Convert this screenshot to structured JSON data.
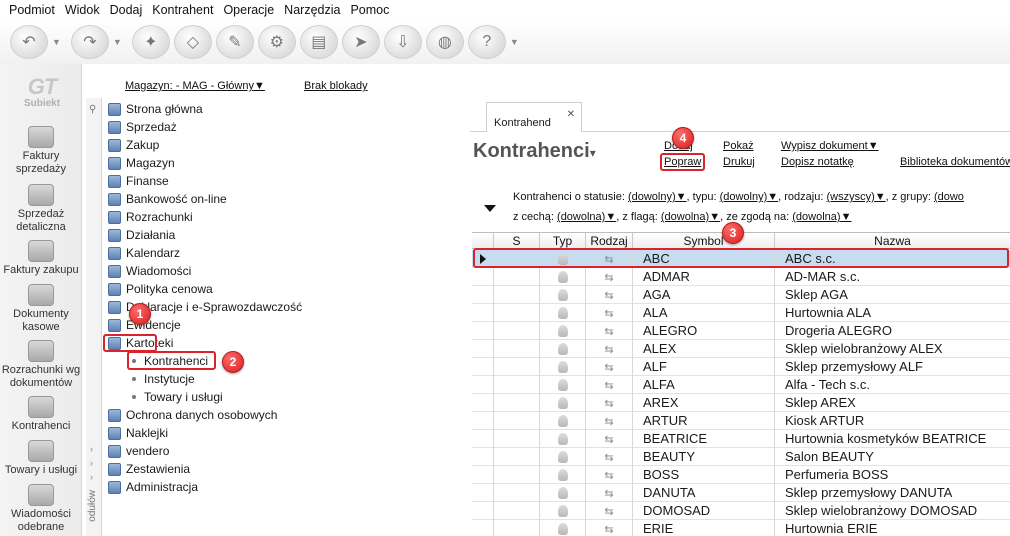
{
  "menu": [
    "Podmiot",
    "Widok",
    "Dodaj",
    "Kontrahent",
    "Operacje",
    "Narzędzia",
    "Pomoc"
  ],
  "logo": {
    "mark": "GT",
    "name": "Subiekt"
  },
  "sidebar": [
    {
      "label": "Faktury sprzedaży",
      "icon": "sales-invoice-icon"
    },
    {
      "label": "Sprzedaż detaliczna",
      "icon": "retail-sales-icon"
    },
    {
      "label": "Faktury zakupu",
      "icon": "purchase-invoice-icon"
    },
    {
      "label": "Dokumenty kasowe",
      "icon": "cash-documents-icon"
    },
    {
      "label": "Rozrachunki wg dokumentów",
      "icon": "settlements-icon"
    },
    {
      "label": "Kontrahenci",
      "icon": "contractors-icon"
    },
    {
      "label": "Towary i usługi",
      "icon": "goods-icon"
    },
    {
      "label": "Wiadomości odebrane",
      "icon": "messages-icon"
    }
  ],
  "infobar": {
    "magazyn": "Magazyn: - MAG - Główny",
    "blokady": "Brak blokady"
  },
  "tree": {
    "strip_label": "odułów",
    "items": [
      {
        "label": "Strona główna"
      },
      {
        "label": "Sprzedaż"
      },
      {
        "label": "Zakup"
      },
      {
        "label": "Magazyn"
      },
      {
        "label": "Finanse"
      },
      {
        "label": "Bankowość on-line"
      },
      {
        "label": "Rozrachunki"
      },
      {
        "label": "Działania"
      },
      {
        "label": "Kalendarz"
      },
      {
        "label": "Wiadomości"
      },
      {
        "label": "Polityka cenowa"
      },
      {
        "label": "Deklaracje i e-Sprawozdawczość"
      },
      {
        "label": "Ewidencje"
      },
      {
        "label": "Kartoteki"
      },
      {
        "label": "Kontrahenci",
        "child": true
      },
      {
        "label": "Instytucje",
        "child": true
      },
      {
        "label": "Towary i usługi",
        "child": true
      },
      {
        "label": "Ochrona danych osobowych"
      },
      {
        "label": "Naklejki"
      },
      {
        "label": "vendero"
      },
      {
        "label": "Zestawienia"
      },
      {
        "label": "Administracja"
      }
    ]
  },
  "tab": {
    "label": "Kontrahend",
    "close": "✕"
  },
  "title": "Kontrahenci",
  "actions": {
    "dodaj": "Dodaj",
    "popraw": "Popraw",
    "pokaz": "Pokaż",
    "drukuj": "Drukuj",
    "wypisz": "Wypisz dokument",
    "notatka": "Dopisz notatkę",
    "biblioteka": "Biblioteka dokumentów"
  },
  "filters": {
    "status_label": "Kontrahenci o statusie:",
    "status_value": "(dowolny)",
    "typ_label": ", typu:",
    "typ_value": "(dowolny)",
    "rodzaj_label": ", rodzaju:",
    "rodzaj_value": "(wszyscy)",
    "grupa_label": ", z grupy:",
    "grupa_value": "(dowo",
    "cecha_label": "z cechą:",
    "cecha_value": "(dowolna)",
    "flaga_label": ", z flagą:",
    "flaga_value": "(dowolna)",
    "zgoda_label": ", ze zgodą na:",
    "zgoda_value": "(dowolna)"
  },
  "columns": {
    "s": "S",
    "typ": "Typ",
    "rodzaj": "Rodzaj",
    "symbol": "Symbol",
    "nazwa": "Nazwa"
  },
  "rows": [
    {
      "symbol": "ABC",
      "nazwa": "ABC s.c."
    },
    {
      "symbol": "ADMAR",
      "nazwa": "AD-MAR s.c."
    },
    {
      "symbol": "AGA",
      "nazwa": "Sklep AGA"
    },
    {
      "symbol": "ALA",
      "nazwa": "Hurtownia ALA"
    },
    {
      "symbol": "ALEGRO",
      "nazwa": "Drogeria ALEGRO"
    },
    {
      "symbol": "ALEX",
      "nazwa": "Sklep wielobranżowy  ALEX"
    },
    {
      "symbol": "ALF",
      "nazwa": "Sklep przemysłowy ALF"
    },
    {
      "symbol": "ALFA",
      "nazwa": "Alfa - Tech s.c."
    },
    {
      "symbol": "AREX",
      "nazwa": "Sklep AREX"
    },
    {
      "symbol": "ARTUR",
      "nazwa": "Kiosk ARTUR"
    },
    {
      "symbol": "BEATRICE",
      "nazwa": "Hurtownia kosmetyków BEATRICE"
    },
    {
      "symbol": "BEAUTY",
      "nazwa": "Salon BEAUTY"
    },
    {
      "symbol": "BOSS",
      "nazwa": "Perfumeria BOSS"
    },
    {
      "symbol": "DANUTA",
      "nazwa": "Sklep przemysłowy DANUTA"
    },
    {
      "symbol": "DOMOSAD",
      "nazwa": "Sklep wielobranżowy DOMOSAD"
    },
    {
      "symbol": "ERIE",
      "nazwa": "Hurtownia ERIE"
    }
  ],
  "callouts": [
    "1",
    "2",
    "3",
    "4"
  ],
  "colors": {
    "highlight": "#d9232d",
    "selected_row": "#c8dcf0"
  }
}
